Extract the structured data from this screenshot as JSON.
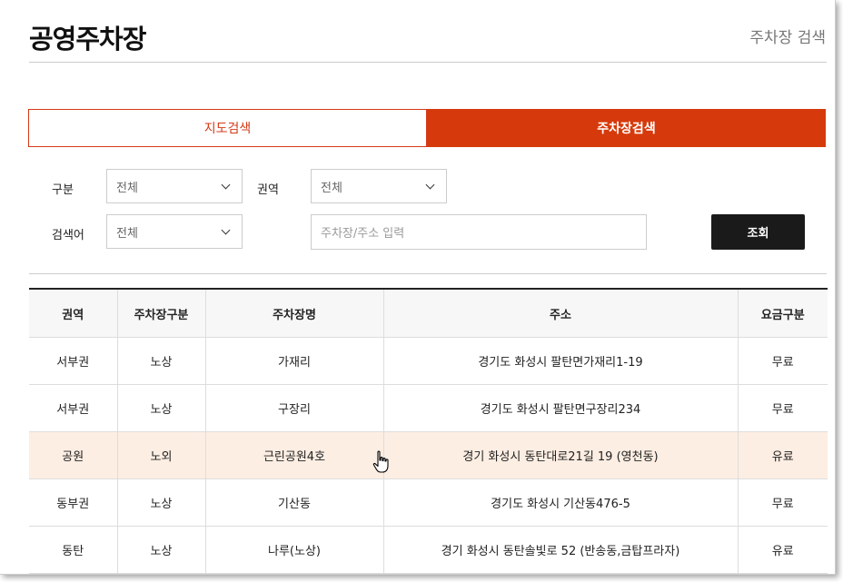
{
  "header": {
    "title": "공영주차장",
    "breadcrumb": "주차장 검색"
  },
  "tabs": [
    {
      "label": "지도검색",
      "active": false
    },
    {
      "label": "주차장검색",
      "active": true
    }
  ],
  "filters": {
    "category_label": "구분",
    "category_value": "전체",
    "region_label": "권역",
    "region_value": "전체",
    "keyword_label": "검색어",
    "keyword_type_value": "전체",
    "keyword_placeholder": "주차장/주소 입력",
    "search_button": "조회"
  },
  "table": {
    "columns": [
      "권역",
      "주차장구분",
      "주차장명",
      "주소",
      "요금구분"
    ],
    "rows": [
      [
        "서부권",
        "노상",
        "가재리",
        "경기도 화성시 팔탄면가재리1-19",
        "무료"
      ],
      [
        "서부권",
        "노상",
        "구장리",
        "경기도 화성시 팔탄면구장리234",
        "무료"
      ],
      [
        "공원",
        "노외",
        "근린공원4호",
        "경기 화성시 동탄대로21길 19 (영천동)",
        "유료"
      ],
      [
        "동부권",
        "노상",
        "기산동",
        "경기도 화성시 기산동476-5",
        "무료"
      ],
      [
        "동탄",
        "노상",
        "나루(노상)",
        "경기 화성시 동탄솔빛로 52 (반송동,금탑프라자)",
        "유료"
      ]
    ],
    "hovered_row": 2
  },
  "colors": {
    "accent": "#d63a0c",
    "hover_row": "#fdeee3",
    "button_dark": "#1a1a1a"
  }
}
